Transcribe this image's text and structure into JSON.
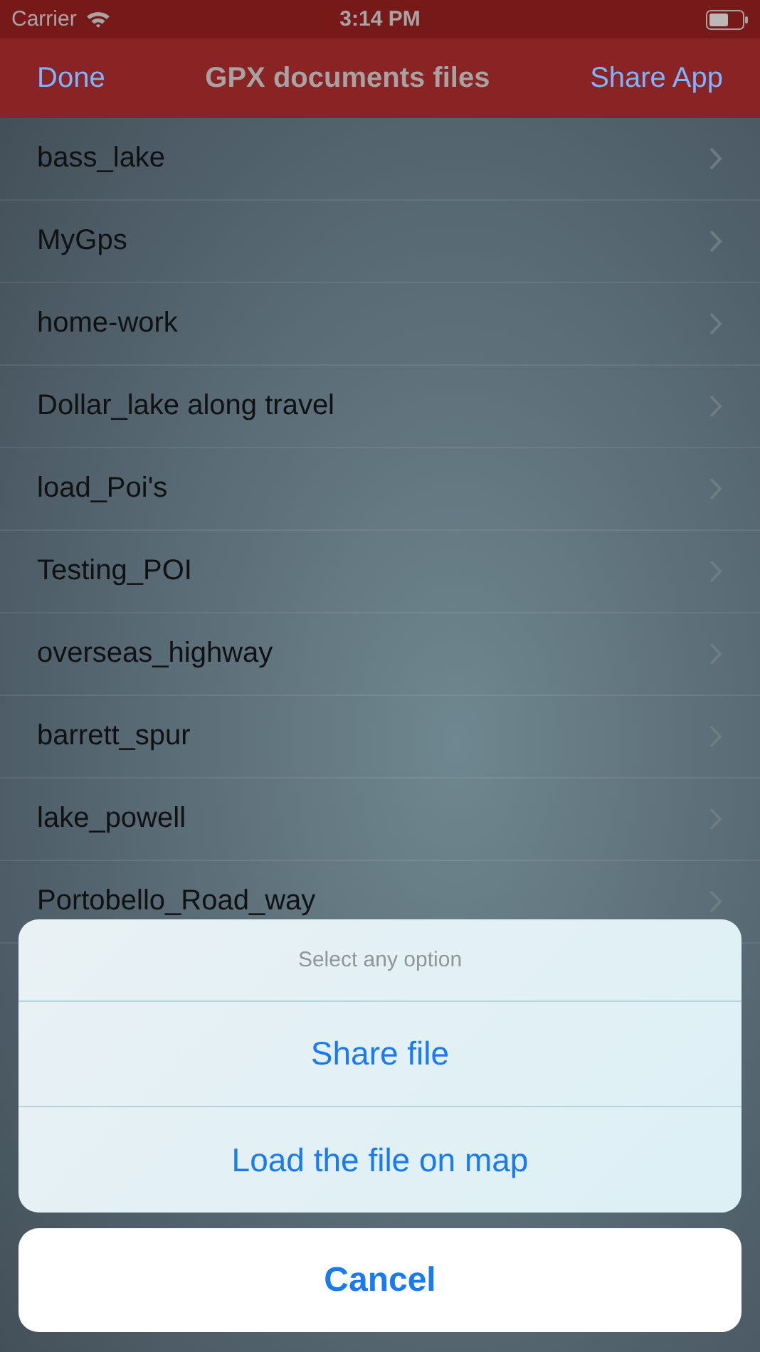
{
  "status_bar": {
    "carrier": "Carrier",
    "time": "3:14 PM"
  },
  "nav_bar": {
    "left_button": "Done",
    "title": "GPX documents files",
    "right_button": "Share App"
  },
  "files": [
    {
      "name": "bass_lake"
    },
    {
      "name": "MyGps"
    },
    {
      "name": "home-work"
    },
    {
      "name": "Dollar_lake along travel"
    },
    {
      "name": "load_Poi's"
    },
    {
      "name": "Testing_POI"
    },
    {
      "name": "overseas_highway"
    },
    {
      "name": "barrett_spur"
    },
    {
      "name": "lake_powell"
    },
    {
      "name": "Portobello_Road_way"
    }
  ],
  "action_sheet": {
    "title": "Select any option",
    "actions": [
      "Share file",
      "Load the file on map"
    ],
    "cancel": "Cancel"
  }
}
